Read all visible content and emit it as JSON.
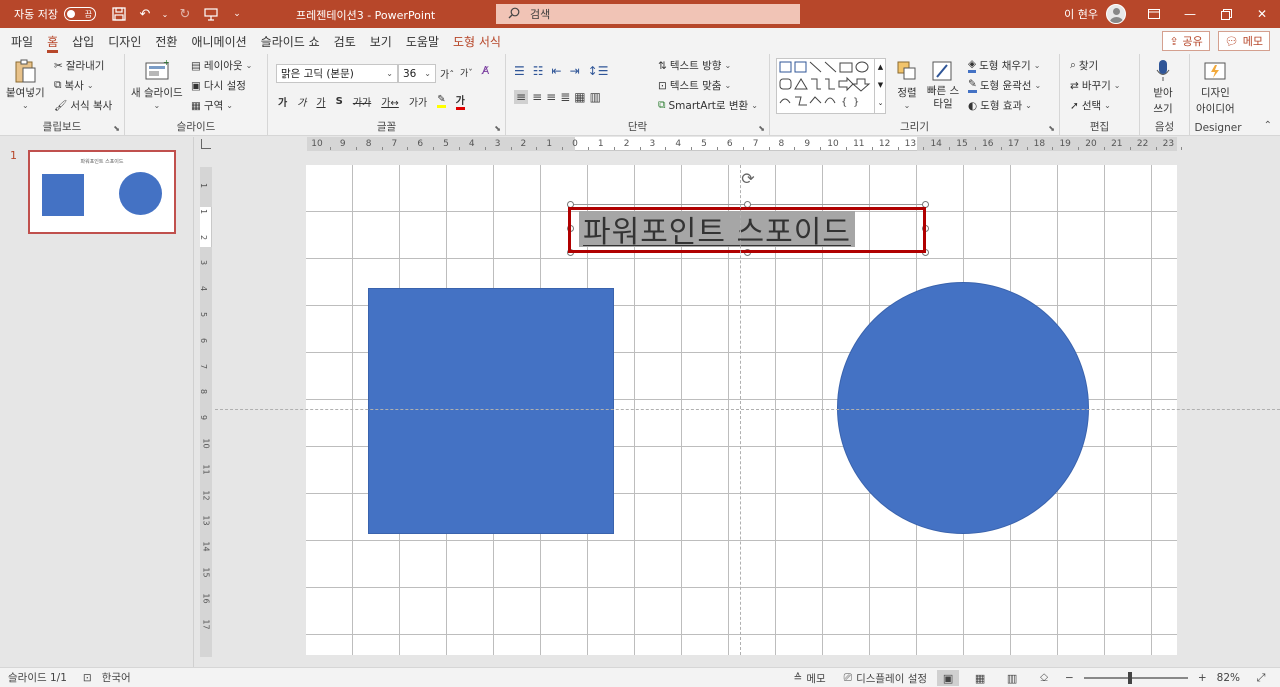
{
  "titlebar": {
    "autosave_label": "자동 저장",
    "autosave_state": "끔",
    "doc_title": "프레젠테이션3  -  PowerPoint",
    "search_placeholder": "검색",
    "user_name": "이 현우"
  },
  "menu": {
    "tabs": [
      "파일",
      "홈",
      "삽입",
      "디자인",
      "전환",
      "애니메이션",
      "슬라이드 쇼",
      "검토",
      "보기",
      "도움말",
      "도형 서식"
    ],
    "active_tab": "홈",
    "share_label": "공유",
    "comments_label": "메모"
  },
  "ribbon": {
    "clipboard": {
      "label": "클립보드",
      "paste": "붙여넣기",
      "cut": "잘라내기",
      "copy": "복사",
      "format_painter": "서식 복사"
    },
    "slides": {
      "label": "슬라이드",
      "new_slide": "새 슬라이드",
      "layout": "레이아웃",
      "reset": "다시 설정",
      "section": "구역"
    },
    "font": {
      "label": "글꼴",
      "font_name": "맑은 고딕 (본문)",
      "font_size": "36"
    },
    "paragraph": {
      "label": "단락",
      "text_direction": "텍스트 방향",
      "align_text": "텍스트 맞춤",
      "smartart": "SmartArt로 변환"
    },
    "drawing": {
      "label": "그리기",
      "arrange": "정렬",
      "quick_styles": "빠른 스타일",
      "shape_fill": "도형 채우기",
      "shape_outline": "도형 윤곽선",
      "shape_effects": "도형 효과"
    },
    "editing": {
      "label": "편집",
      "find": "찾기",
      "replace": "바꾸기",
      "select": "선택"
    },
    "voice": {
      "label": "음성",
      "dictate_1": "받아",
      "dictate_2": "쓰기"
    },
    "designer": {
      "label": "Designer",
      "ideas_1": "디자인",
      "ideas_2": "아이디어"
    }
  },
  "thumbnails": {
    "slide_number": "1",
    "thumb_title": "파워포인트 스포이드"
  },
  "ruler": {
    "h_ticks": [
      "10",
      "9",
      "8",
      "7",
      "6",
      "5",
      "4",
      "3",
      "2",
      "1",
      "0",
      "1",
      "2",
      "3",
      "4",
      "5",
      "6",
      "7",
      "8",
      "9",
      "10",
      "11",
      "12",
      "13",
      "14",
      "15",
      "16",
      "17",
      "18",
      "19",
      "20",
      "21",
      "22",
      "23"
    ],
    "v_ticks": [
      "1",
      "1",
      "2",
      "3",
      "4",
      "5",
      "6",
      "7",
      "8",
      "9",
      "10",
      "11",
      "12",
      "13",
      "14",
      "15",
      "16",
      "17"
    ]
  },
  "slide": {
    "title_text": "파워포인트 스포이드"
  },
  "colors": {
    "accent": "#b7472a",
    "shape_fill": "#4472c4",
    "selection_outline": "#b00000"
  },
  "statusbar": {
    "slide_count": "슬라이드 1/1",
    "language": "한국어",
    "notes": "메모",
    "display_settings": "디스플레이 설정",
    "zoom": "82%"
  }
}
